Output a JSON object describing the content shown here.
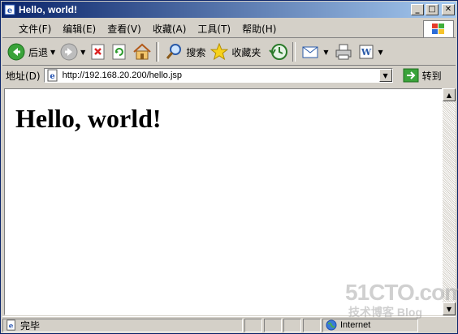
{
  "window": {
    "title": "Hello, world!"
  },
  "title_buttons": {
    "minimize": "_",
    "maximize": "□",
    "close": "✕"
  },
  "menu": [
    "文件(F)",
    "编辑(E)",
    "查看(V)",
    "收藏(A)",
    "工具(T)",
    "帮助(H)"
  ],
  "toolbar": {
    "back": "后退",
    "search": "搜索",
    "favorites": "收藏夹"
  },
  "address": {
    "label": "地址(D)",
    "url": "http://192.168.20.200/hello.jsp",
    "go": "转到"
  },
  "page": {
    "heading": "Hello, world!"
  },
  "status": {
    "text": "完毕",
    "zone": "Internet"
  },
  "watermark": {
    "line1": "51CTO.com",
    "line2": "技术博客 Blog"
  },
  "colors": {
    "title_start": "#0a246a",
    "title_end": "#a6caf0",
    "chrome": "#d4d0c8",
    "go_green": "#3aa33a"
  },
  "icons": [
    "ie-icon",
    "back-icon",
    "forward-icon",
    "stop-icon",
    "refresh-icon",
    "home-icon",
    "search-icon",
    "favorites-icon",
    "history-icon",
    "mail-icon",
    "print-icon",
    "edit-icon",
    "go-icon",
    "page-icon",
    "globe-icon",
    "windows-logo-icon"
  ]
}
